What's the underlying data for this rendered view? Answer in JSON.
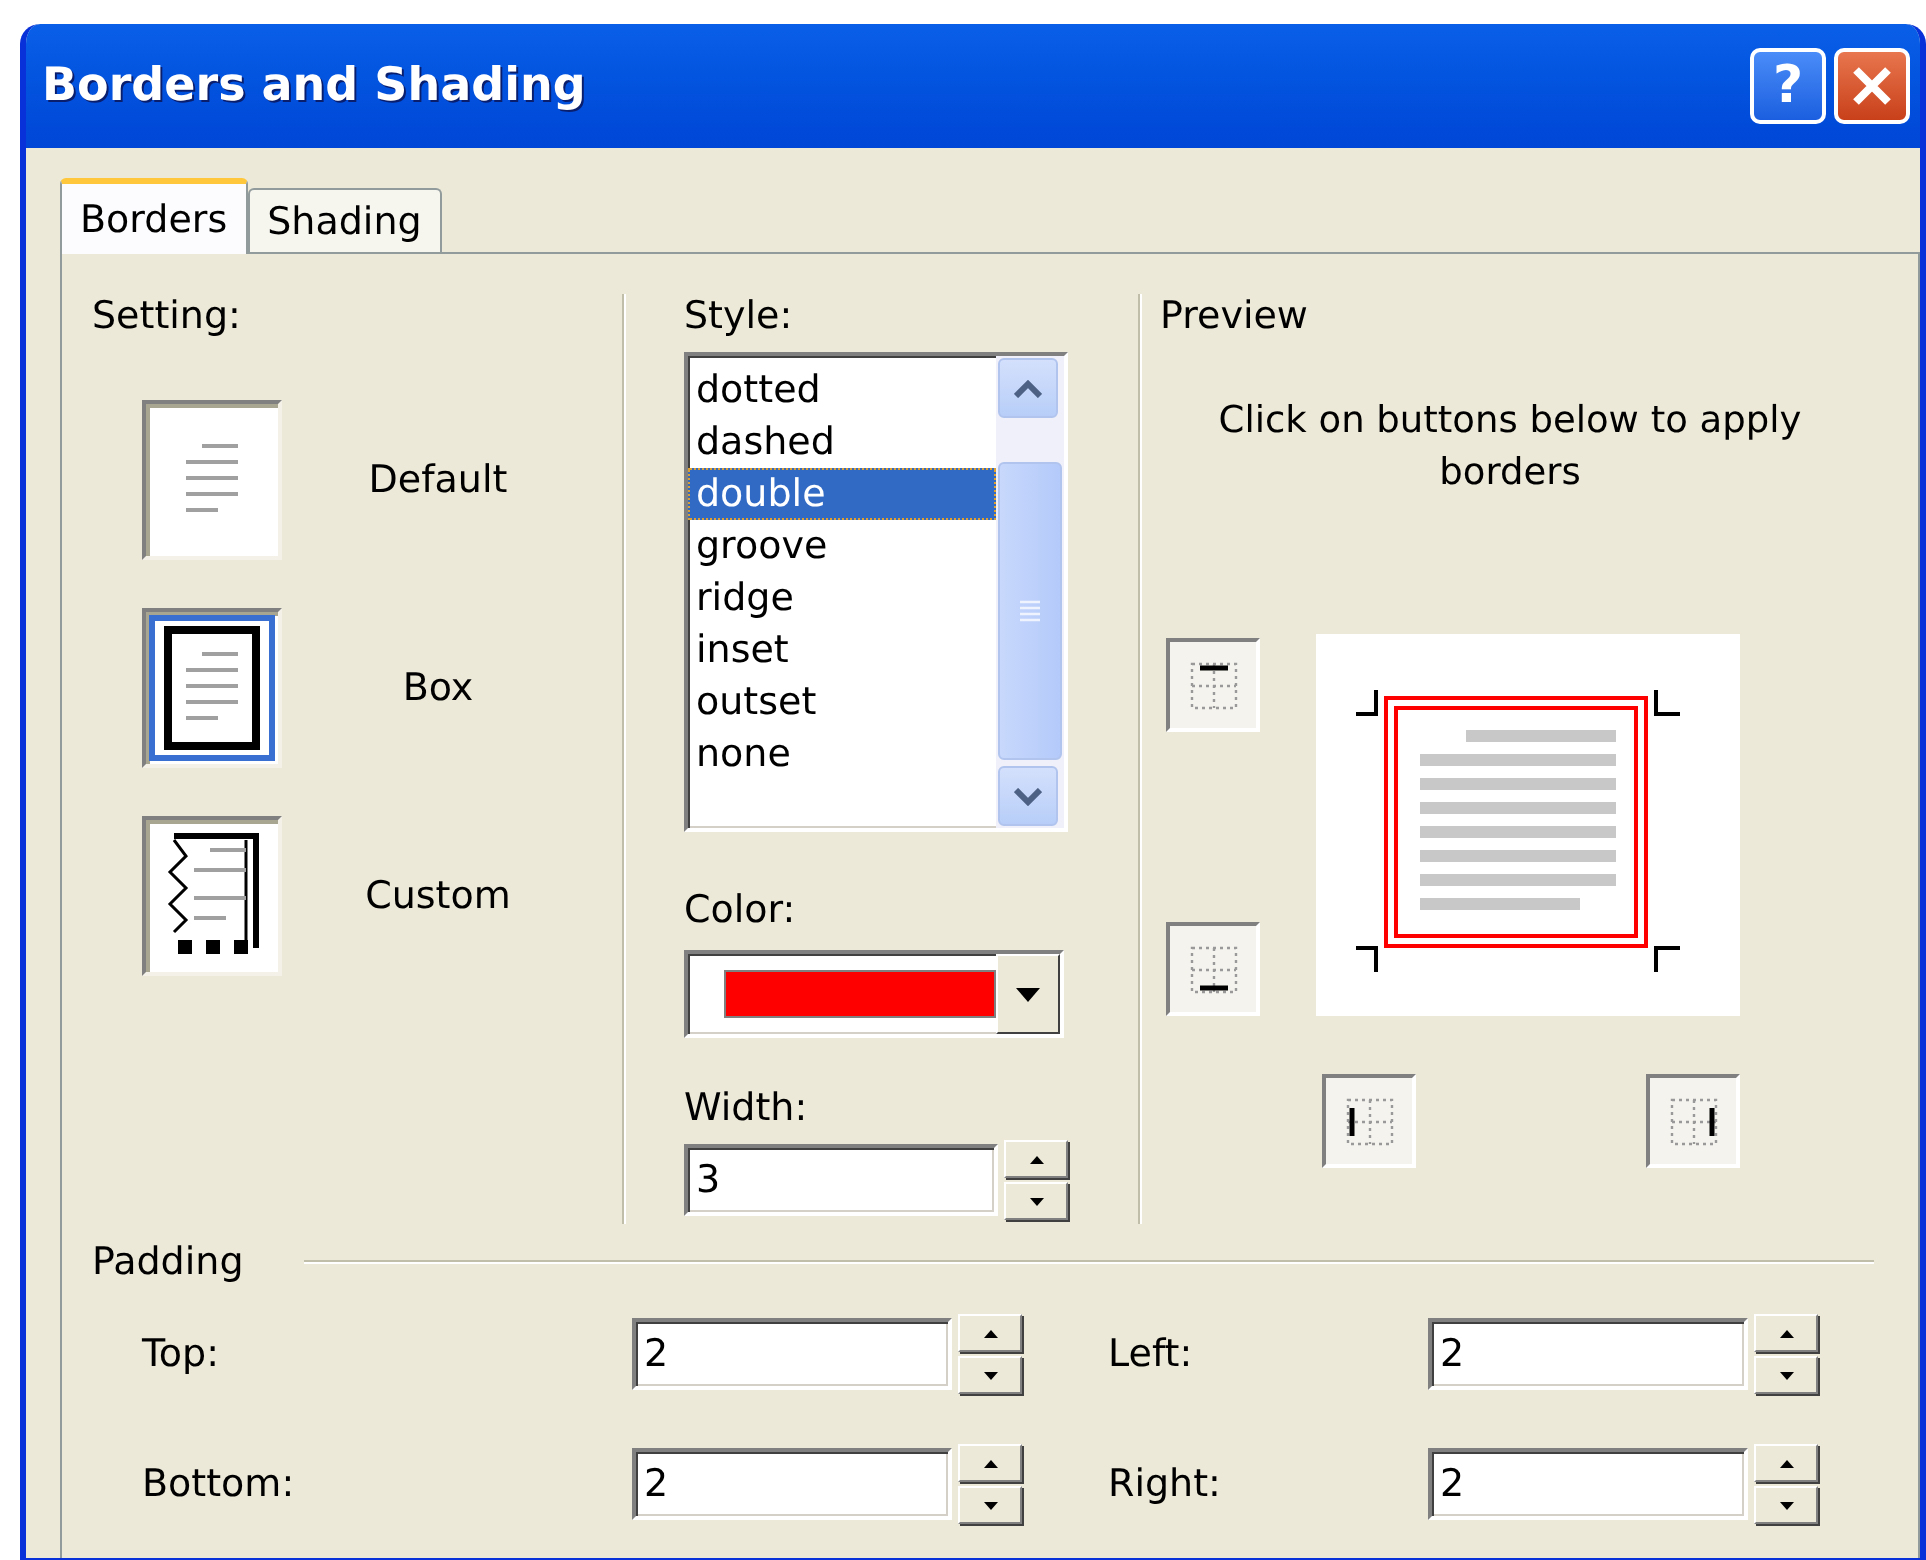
{
  "window": {
    "title": "Borders and Shading",
    "help_button": "?"
  },
  "tabs": [
    {
      "label": "Borders",
      "selected": true
    },
    {
      "label": "Shading",
      "selected": false
    }
  ],
  "setting": {
    "label": "Setting:",
    "options": [
      {
        "label": "Default",
        "kind": "default",
        "selected": false
      },
      {
        "label": "Box",
        "kind": "box",
        "selected": true
      },
      {
        "label": "Custom",
        "kind": "custom",
        "selected": false
      }
    ]
  },
  "style": {
    "label": "Style:",
    "items": [
      {
        "label": "dotted",
        "selected": false
      },
      {
        "label": "dashed",
        "selected": false
      },
      {
        "label": "double",
        "selected": true
      },
      {
        "label": "groove",
        "selected": false
      },
      {
        "label": "ridge",
        "selected": false
      },
      {
        "label": "inset",
        "selected": false
      },
      {
        "label": "outset",
        "selected": false
      },
      {
        "label": "none",
        "selected": false
      }
    ]
  },
  "color": {
    "label": "Color:",
    "color": "#ff0000"
  },
  "width": {
    "label": "Width:",
    "value": "3"
  },
  "preview": {
    "label": "Preview",
    "hint": "Click on buttons below to apply borders"
  },
  "padding": {
    "label": "Padding",
    "fields": [
      {
        "label": "Top:",
        "value": "2"
      },
      {
        "label": "Left:",
        "value": "2"
      },
      {
        "label": "Bottom:",
        "value": "2"
      },
      {
        "label": "Right:",
        "value": "2"
      }
    ]
  }
}
